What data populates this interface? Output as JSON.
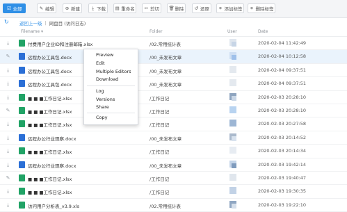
{
  "toolbar": {
    "buttons": [
      {
        "label": "全部",
        "icon": "check-icon"
      },
      {
        "label": "编辑",
        "icon": "edit-icon"
      },
      {
        "label": "新建",
        "icon": "plus-icon"
      },
      {
        "label": "下载",
        "icon": "download-icon"
      },
      {
        "label": "重命名",
        "icon": "rename-icon"
      },
      {
        "label": "剪切",
        "icon": "scissors-icon"
      },
      {
        "label": "删除",
        "icon": "trash-icon"
      },
      {
        "label": "还原",
        "icon": "restore-icon"
      },
      {
        "label": "添加标签",
        "icon": "tag-icon"
      },
      {
        "label": "删除标签",
        "icon": "tag-remove-icon"
      }
    ]
  },
  "breadcrumb": {
    "back": "返回上一级",
    "separator": "|",
    "current": "网盘目 (访问日志)"
  },
  "table": {
    "headers": {
      "filename": "Filename ▾",
      "folder": "Folder",
      "user": "User",
      "date": "Date"
    },
    "rows": [
      {
        "icon": "download-icon",
        "type": "xlsx",
        "name": "付费用户企业ID和注册邮箱.xlsx",
        "folder": "/02.常用统计表",
        "user_colors": [
          "#dfe6ee",
          "#c7d5e6"
        ],
        "date": "2020-02-04 11:42:49",
        "selected": false
      },
      {
        "icon": "edit-icon",
        "type": "docx",
        "name": "远程办公工具包.docx",
        "folder": "/00_未发布文章",
        "user_colors": [
          "#cfdff3",
          "#9fc0ea"
        ],
        "date": "2020-02-04 10:12:58",
        "selected": true
      },
      {
        "icon": "download-icon",
        "type": "docx",
        "name": "远程办公工具包.docx",
        "folder": "/00_未发布文章",
        "user_colors": [
          "#e4e9ef"
        ],
        "date": "2020-02-04 09:37:51",
        "selected": false
      },
      {
        "icon": "download-icon",
        "type": "docx",
        "name": "远程办公工具包.docx",
        "folder": "/00_未发布文章",
        "user_colors": [
          "#e4e9ef"
        ],
        "date": "2020-02-04 09:37:51",
        "selected": false
      },
      {
        "icon": "download-icon",
        "type": "xlsx",
        "name": "■ ■ ■工作日记.xlsx",
        "folder": "/工作日记",
        "user_colors": [
          "#8ea4bf",
          "#c9d6e6"
        ],
        "date": "2020-02-03 20:28:10",
        "selected": false
      },
      {
        "icon": "edit-icon",
        "type": "xlsx",
        "name": "■ ■ ■工作日记.xlsx",
        "folder": "/工作日记",
        "user_colors": [
          "#b8d3f0"
        ],
        "date": "2020-02-03 20:28:10",
        "selected": false
      },
      {
        "icon": "download-icon",
        "type": "xlsx",
        "name": "■ ■ ■工作日记.xlsx",
        "folder": "/工作日记",
        "user_colors": [
          "#9db6d4"
        ],
        "date": "2020-02-03 20:27:58",
        "selected": false
      },
      {
        "icon": "download-icon",
        "type": "docx",
        "name": "远程办公行业观察.docx",
        "folder": "/00_未发布文章",
        "user_colors": [
          "#aab9cc",
          "#d8e2ee"
        ],
        "date": "2020-02-03 20:14:52",
        "selected": false
      },
      {
        "icon": "download-icon",
        "type": "xlsx",
        "name": "■ ■ ■工作日记.xlsx",
        "folder": "/工作日记",
        "user_colors": [
          "#e7ecf2"
        ],
        "date": "2020-02-03 20:14:34",
        "selected": false
      },
      {
        "icon": "download-icon",
        "type": "docx",
        "name": "远程办公行业观察.docx",
        "folder": "/00_未发布文章",
        "user_colors": [
          "#c4d4e8",
          "#7f9bbd"
        ],
        "date": "2020-02-03 19:42:14",
        "selected": false
      },
      {
        "icon": "edit-icon",
        "type": "xlsx",
        "name": "■ ■ ■工作日记.xlsx",
        "folder": "/工作日记",
        "user_colors": [
          "#e0e6ed"
        ],
        "date": "2020-02-03 19:40:47",
        "selected": false
      },
      {
        "icon": "download-icon",
        "type": "xlsx",
        "name": "■ ■ ■工作日记.xlsx",
        "folder": "/工作日记",
        "user_colors": [
          "#c2d2e6"
        ],
        "date": "2020-02-03 19:30:35",
        "selected": false
      },
      {
        "icon": "download-icon",
        "type": "xlsx",
        "name": "访问用户分析表_v3.9.xls",
        "folder": "/02.常用统计表",
        "user_colors": [
          "#8fa6c2",
          "#d5dfeb"
        ],
        "date": "2020-02-03 19:22:10",
        "selected": false
      }
    ]
  },
  "context_menu": {
    "items": [
      "Preview",
      "Edit",
      "Multiple Editors",
      "Download",
      "Log",
      "Versions",
      "Share",
      "Copy"
    ]
  }
}
